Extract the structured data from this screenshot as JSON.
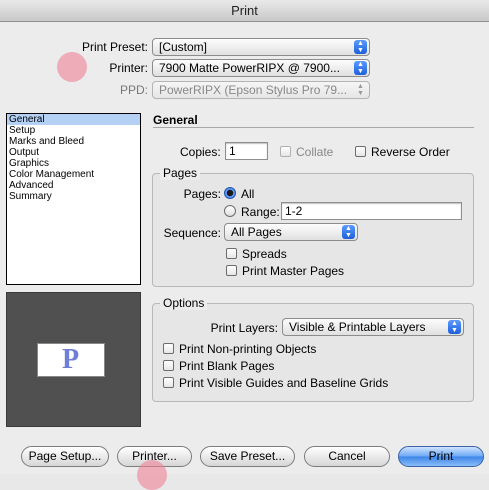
{
  "window": {
    "title": "Print"
  },
  "header": {
    "print_preset_label": "Print Preset:",
    "print_preset_value": "[Custom]",
    "printer_label": "Printer:",
    "printer_value": "7900 Matte PowerRIPX @ 7900...",
    "ppd_label": "PPD:",
    "ppd_value": "PowerRIPX (Epson Stylus Pro 79..."
  },
  "sidebar": {
    "items": [
      {
        "label": "General",
        "selected": true
      },
      {
        "label": "Setup"
      },
      {
        "label": "Marks and Bleed"
      },
      {
        "label": "Output"
      },
      {
        "label": "Graphics"
      },
      {
        "label": "Color Management"
      },
      {
        "label": "Advanced"
      },
      {
        "label": "Summary"
      }
    ],
    "preview_letter": "P"
  },
  "general": {
    "heading": "General",
    "copies_label": "Copies:",
    "copies_value": "1",
    "collate_label": "Collate",
    "collate_checked": false,
    "reverse_label": "Reverse Order",
    "reverse_checked": false
  },
  "pages": {
    "group_title": "Pages",
    "pages_label": "Pages:",
    "all_label": "All",
    "all_selected": true,
    "range_label": "Range:",
    "range_value": "1-2",
    "sequence_label": "Sequence:",
    "sequence_value": "All Pages",
    "spreads_label": "Spreads",
    "spreads_checked": false,
    "master_label": "Print Master Pages",
    "master_checked": false
  },
  "options": {
    "group_title": "Options",
    "layers_label": "Print Layers:",
    "layers_value": "Visible & Printable Layers",
    "nonprinting_label": "Print Non-printing Objects",
    "blank_label": "Print Blank Pages",
    "guides_label": "Print Visible Guides and Baseline Grids"
  },
  "footer": {
    "page_setup": "Page Setup...",
    "printer": "Printer...",
    "save_preset": "Save Preset...",
    "cancel": "Cancel",
    "print": "Print"
  },
  "colors": {
    "accent": "#3d85e8",
    "selection": "#b5d0f5",
    "preview_bg": "#505050",
    "preview_letter": "#6f7fd8",
    "marker": "#ef8296"
  }
}
